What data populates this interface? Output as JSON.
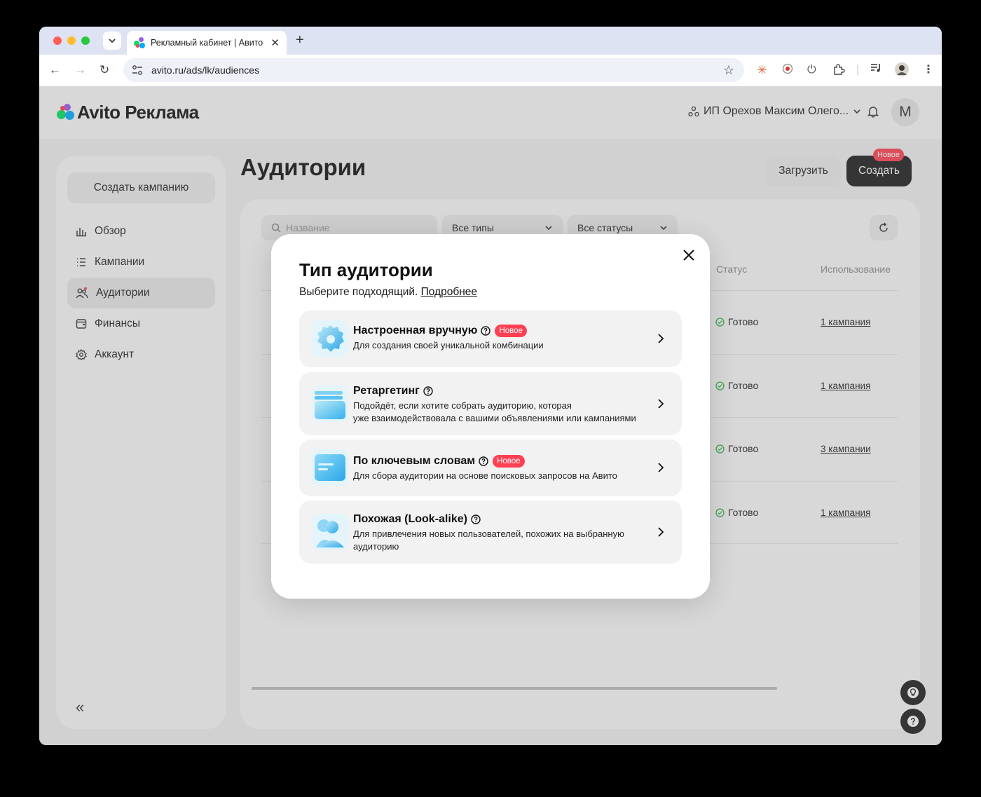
{
  "browser": {
    "tab_title": "Рекламный кабинет | Авито",
    "url": "avito.ru/ads/lk/audiences"
  },
  "header": {
    "logo_text": "Avito Реклама",
    "account_name": "ИП Орехов Максим Олего...",
    "avatar_letter": "М"
  },
  "sidebar": {
    "create_label": "Создать кампанию",
    "items": [
      {
        "label": "Обзор"
      },
      {
        "label": "Кампании"
      },
      {
        "label": "Аудитории"
      },
      {
        "label": "Финансы"
      },
      {
        "label": "Аккаунт"
      }
    ],
    "collapse_glyph": "«"
  },
  "page": {
    "title": "Аудитории",
    "upload_label": "Загрузить",
    "create_label": "Создать",
    "create_badge": "Новое"
  },
  "filters": {
    "search_placeholder": "Название",
    "type_select": "Все типы",
    "status_select": "Все статусы"
  },
  "table": {
    "headers": {
      "status": "Статус",
      "usage": "Использование"
    },
    "rows": [
      {
        "status": "Готово",
        "usage": "1 кампания"
      },
      {
        "status": "Готово",
        "usage": "1 кампания"
      },
      {
        "status": "Готово",
        "usage": "3 кампании"
      },
      {
        "status": "Готово",
        "usage": "1 кампания"
      }
    ]
  },
  "modal": {
    "title": "Тип аудитории",
    "subtitle": "Выберите подходящий.",
    "more_link": "Подробнее",
    "options": [
      {
        "name": "Настроенная вручную",
        "badge": "Новое",
        "desc": "Для создания своей уникальной комбинации"
      },
      {
        "name": "Ретаргетинг",
        "badge": "",
        "desc_line1": "Подойдёт, если хотите собрать аудиторию, которая",
        "desc_line2": "уже взаимодействовала с вашими объявлениями или кампаниями"
      },
      {
        "name": "По ключевым словам",
        "badge": "Новое",
        "desc": "Для сбора аудитории на основе поисковых запросов на Авито"
      },
      {
        "name": "Похожая (Look-alike)",
        "badge": "",
        "desc_line1": "Для привлечения новых пользователей, похожих на выбранную",
        "desc_line2": "аудиторию"
      }
    ]
  },
  "colors": {
    "accent_badge": "#ff4053",
    "dark_button": "#1e1e1e",
    "status_ok": "#2fb34a"
  }
}
